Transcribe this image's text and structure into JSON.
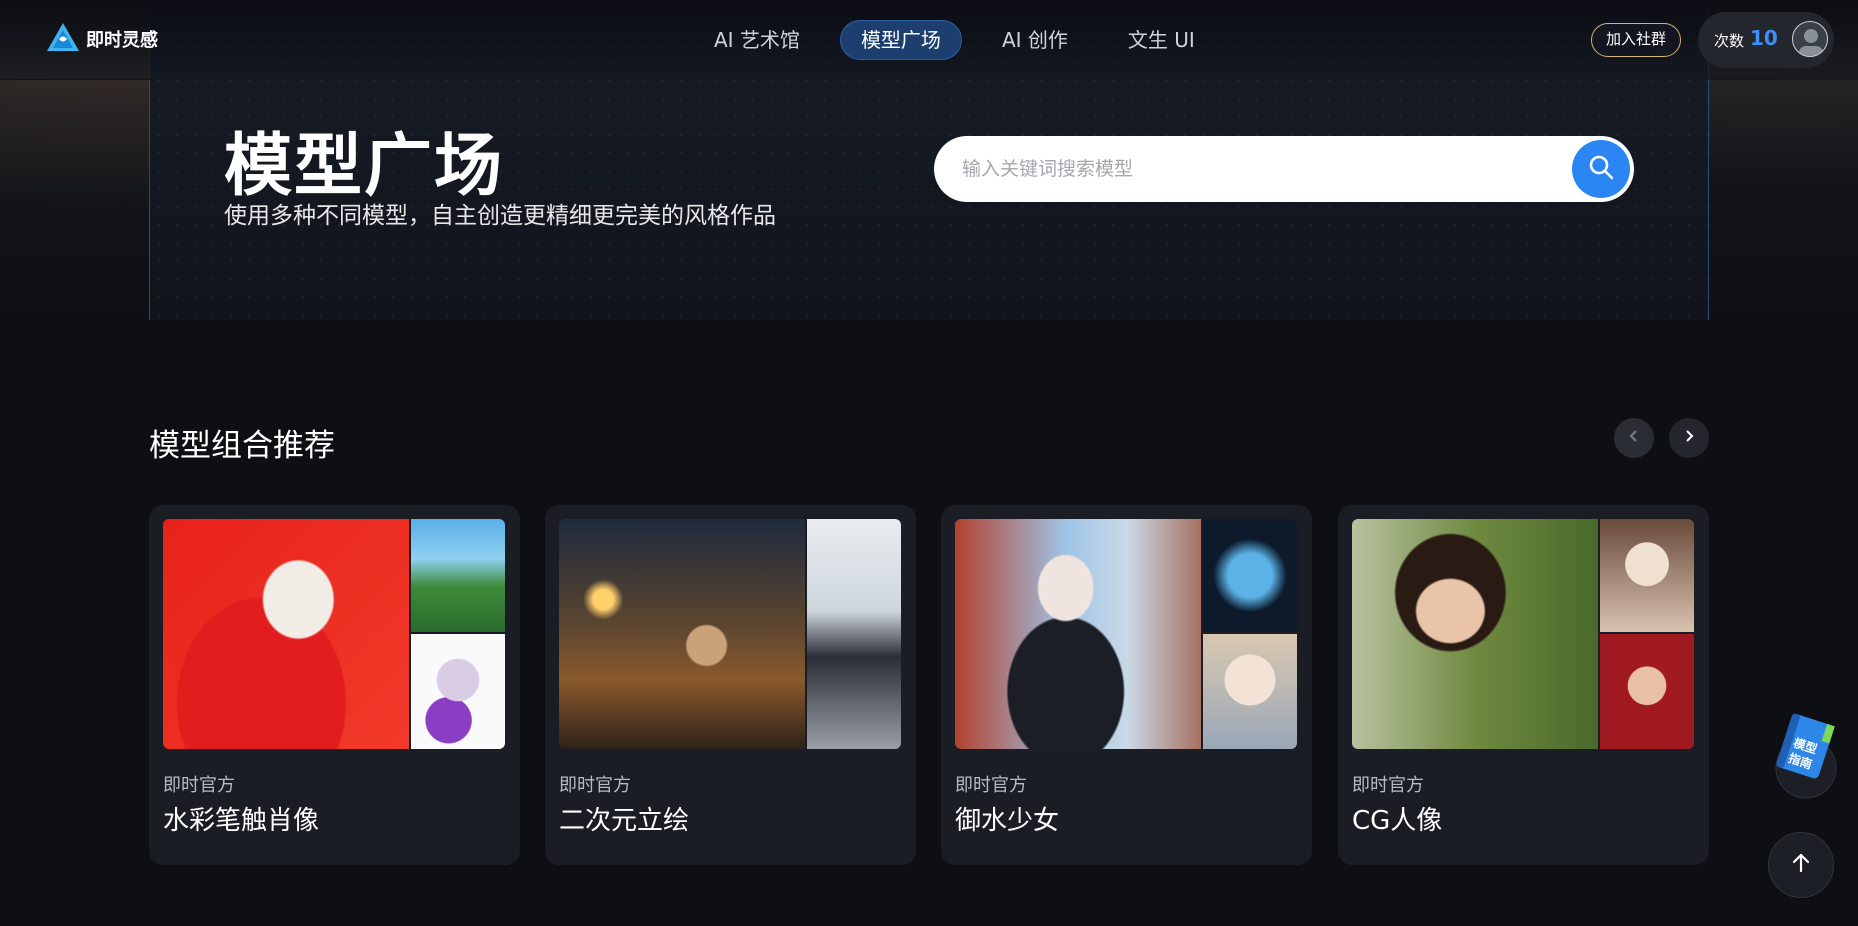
{
  "nav": {
    "logo_text": "即时灵感",
    "tabs": [
      {
        "label": "AI 艺术馆",
        "active": false
      },
      {
        "label": "模型广场",
        "active": true
      },
      {
        "label": "AI 创作",
        "active": false
      },
      {
        "label": "文生 UI",
        "active": false
      }
    ],
    "join_label": "加入社群",
    "count_label": "次数",
    "count_value": "10"
  },
  "hero": {
    "title": "模型广场",
    "subtitle": "使用多种不同模型，自主创造更精细更完美的风格作品"
  },
  "search": {
    "placeholder": "输入关键词搜索模型"
  },
  "section": {
    "title": "模型组合推荐"
  },
  "cards": [
    {
      "author": "即时官方",
      "name": "水彩笔触肖像"
    },
    {
      "author": "即时官方",
      "name": "二次元立绘"
    },
    {
      "author": "即时官方",
      "name": "御水少女"
    },
    {
      "author": "即时官方",
      "name": "CG人像"
    }
  ],
  "floating": {
    "guide_label": "模型指南"
  },
  "colors": {
    "accent": "#2b86f3",
    "active_tab_bg": "#1d3f6f",
    "join_border": "#d9b375",
    "count_value": "#3d8ef5"
  },
  "icons": [
    "logo-icon",
    "search-icon",
    "chevron-left-icon",
    "chevron-right-icon",
    "book-icon",
    "arrow-up-icon"
  ]
}
